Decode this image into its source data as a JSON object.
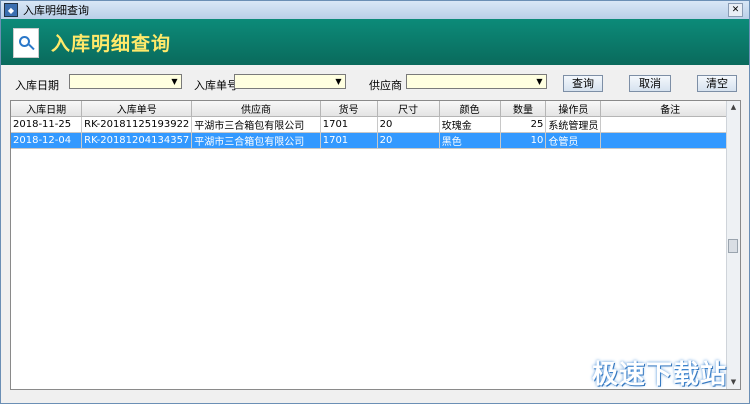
{
  "window": {
    "title": "入库明细查询",
    "close_glyph": "✕",
    "app_icon": "app-icon"
  },
  "banner": {
    "title": "入库明细查询",
    "icon": "search-document-icon"
  },
  "filters": {
    "date_label": "入库日期",
    "order_label": "入库单号",
    "supplier_label": "供应商",
    "query_button": "查询",
    "cancel_button": "取消",
    "clear_button": "清空",
    "dropdown_glyph": "▼"
  },
  "table": {
    "columns": [
      "入库日期",
      "入库单号",
      "供应商",
      "货号",
      "尺寸",
      "颜色",
      "数量",
      "操作员",
      "备注"
    ],
    "rows": [
      {
        "date": "2018-11-25",
        "order": "RK-20181125193922",
        "supplier": "平湖市三合箱包有限公司",
        "sku": "1701",
        "size": "20",
        "color": "玫瑰金",
        "qty": "25",
        "operator": "系统管理员",
        "note": "",
        "selected": false
      },
      {
        "date": "2018-12-04",
        "order": "RK-20181204134357",
        "supplier": "平湖市三合箱包有限公司",
        "sku": "1701",
        "size": "20",
        "color": "黑色",
        "qty": "10",
        "operator": "仓管员",
        "note": "",
        "selected": true
      }
    ]
  },
  "scrollbar": {
    "up_glyph": "▲",
    "down_glyph": "▼"
  },
  "watermark": {
    "text": "极速下载站"
  },
  "colors": {
    "banner": "#0a7a6a",
    "banner_title": "#ffe96a",
    "selection": "#3399ff",
    "combo_bg": "#ffffe0"
  }
}
